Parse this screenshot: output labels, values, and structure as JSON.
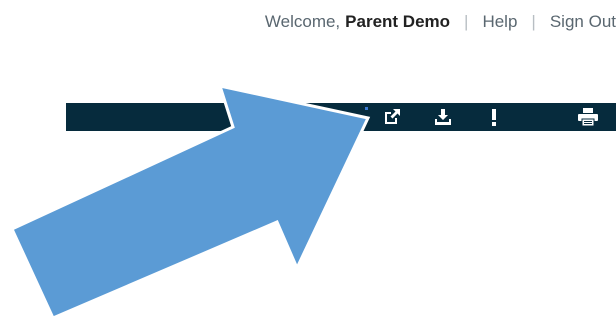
{
  "user_bar": {
    "welcome_prefix": "Welcome,",
    "user_name": "Parent Demo",
    "separator": "|",
    "help_label": "Help",
    "sign_out_label": "Sign Out"
  },
  "toolbar": {
    "background_color": "#062b3d",
    "icon_color": "#ffffff",
    "icons": [
      {
        "name": "open-external-icon"
      },
      {
        "name": "download-icon"
      },
      {
        "name": "alert-icon"
      },
      {
        "name": "print-icon"
      }
    ]
  },
  "annotation": {
    "arrow_fill": "#5b9bd5",
    "arrow_stroke": "#ffffff"
  }
}
